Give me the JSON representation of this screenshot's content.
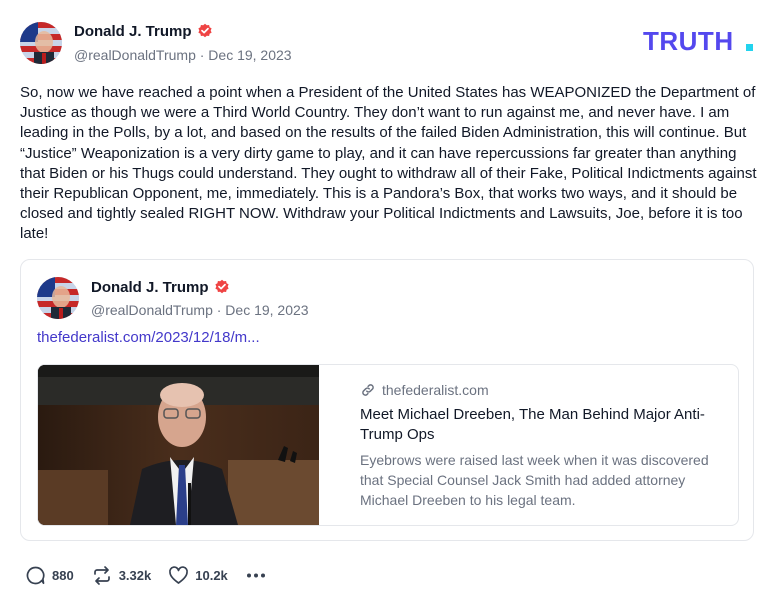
{
  "author": {
    "name": "Donald J. Trump",
    "handle": "@realDonaldTrump",
    "date": "Dec 19, 2023"
  },
  "handle_line": "@realDonaldTrump · Dec 19, 2023",
  "brand": {
    "logo_text": "TRUTH",
    "color": "#5448ee",
    "accent": "#22d3ee"
  },
  "post_text": "So, now we have reached a point when a President of the United States has WEAPONIZED the Department of Justice as though we were a Third World Country. They don’t want to run against me, and never have. I am leading in the Polls, by a lot, and based on the results of the failed Biden Administration, this will continue. But “Justice” Weaponization is a very dirty game to play, and it can have repercussions far greater than anything that Biden or his Thugs could understand. They ought to withdraw all of their Fake, Political Indictments against their Republican Opponent, me, immediately. This is a Pandora’s Box, that works two ways, and it should be closed and tightly sealed RIGHT NOW. Withdraw your Political Indictments and Lawsuits, Joe, before it is too late!",
  "quoted": {
    "name": "Donald J. Trump",
    "handle_line": "@realDonaldTrump · Dec 19, 2023",
    "link_text": "thefederalist.com/2023/12/18/m...",
    "card": {
      "domain": "thefederalist.com",
      "title": "Meet Michael Dreeben, The Man Behind Major Anti-Trump Ops",
      "description": "Eyebrows were raised last week when it was discovered that Special Counsel Jack Smith had added attorney Michael Dreeben to his legal team."
    }
  },
  "stats": {
    "replies": "880",
    "retruths": "3.32k",
    "likes": "10.2k"
  },
  "icons": {
    "verified": "verified-badge-icon",
    "link": "link-icon",
    "reply": "reply-icon",
    "retruth": "retruth-icon",
    "like": "heart-icon",
    "more": "more-icon"
  },
  "colors": {
    "verified": "#ef4444",
    "link": "#4338ca",
    "muted": "#6b7280"
  }
}
